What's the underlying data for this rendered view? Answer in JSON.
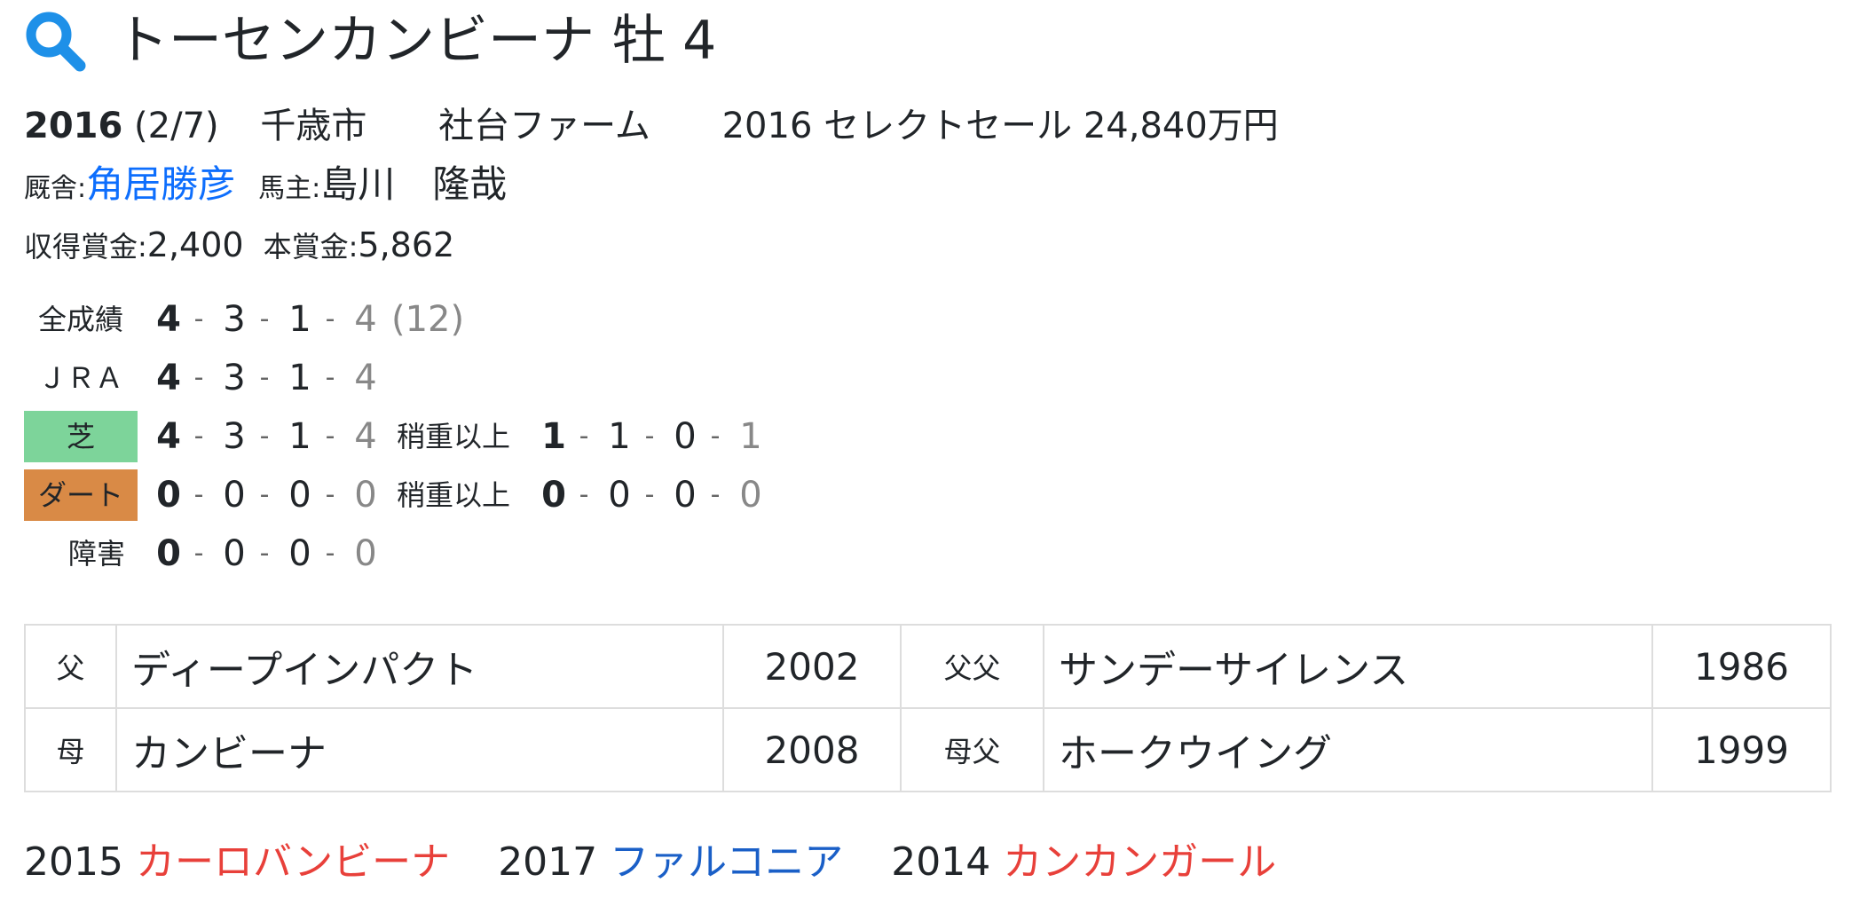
{
  "header": {
    "icon": "search-icon",
    "horse_name": "トーセンカンビーナ",
    "sex_age": "牡 4",
    "icon_color": "#1e90e8"
  },
  "info": {
    "birth_year": "2016",
    "birth_date": "(2/7)",
    "region": "千歳市",
    "breeder": "社台ファーム",
    "sale": "2016 セレクトセール 24,840万円"
  },
  "stable": {
    "trainer_label": "厩舎:",
    "trainer": "角居勝彦",
    "owner_label": "馬主:",
    "owner": "島川　隆哉"
  },
  "prize": {
    "earned_label": "収得賞金:",
    "earned": "2,400",
    "main_label": "本賞金:",
    "main": "5,862"
  },
  "records": {
    "all": {
      "label": "全成績",
      "w": "4",
      "s": "3",
      "t": "1",
      "o": "4",
      "total": "(12)"
    },
    "jra": {
      "label": "ＪＲＡ",
      "w": "4",
      "s": "3",
      "t": "1",
      "o": "4"
    },
    "turf": {
      "label": "芝",
      "w": "4",
      "s": "3",
      "t": "1",
      "o": "4",
      "cond_label": "稍重以上",
      "cw": "1",
      "cs": "1",
      "ct": "0",
      "co": "1",
      "color": "#7dd49a"
    },
    "dirt": {
      "label": "ダート",
      "w": "0",
      "s": "0",
      "t": "0",
      "o": "0",
      "cond_label": "稍重以上",
      "cw": "0",
      "cs": "0",
      "ct": "0",
      "co": "0",
      "color": "#d98a46"
    },
    "jump": {
      "label": "障害",
      "w": "0",
      "s": "0",
      "t": "0",
      "o": "0"
    },
    "dash": "-"
  },
  "pedigree": {
    "rows": [
      {
        "rel": "父",
        "name": "ディープインパクト",
        "year": "2002",
        "rel2": "父父",
        "name2": "サンデーサイレンス",
        "year2": "1986"
      },
      {
        "rel": "母",
        "name": "カンビーナ",
        "year": "2008",
        "rel2": "母父",
        "name2": "ホークウイング",
        "year2": "1999"
      }
    ]
  },
  "siblings": [
    {
      "year": "2015",
      "name": "カーロバンビーナ",
      "color": "red"
    },
    {
      "year": "2017",
      "name": "ファルコニア",
      "color": "blue"
    },
    {
      "year": "2014",
      "name": "カンカンガール",
      "color": "red"
    }
  ]
}
